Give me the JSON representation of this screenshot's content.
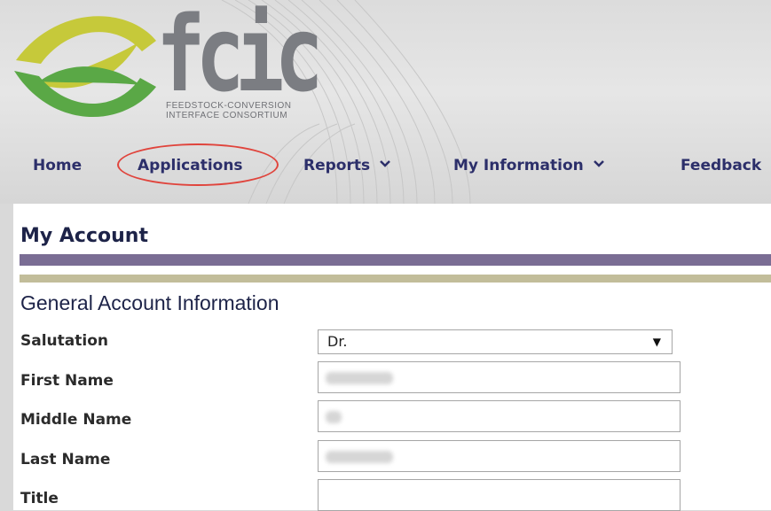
{
  "brand": {
    "logo_text": "fcic",
    "tagline_line1": "FEEDSTOCK-CONVERSION",
    "tagline_line2": "INTERFACE CONSORTIUM",
    "colors": {
      "accent_yellow": "#c6c93a",
      "accent_green": "#5aa846",
      "logo_gray": "#7b7d82"
    }
  },
  "nav": {
    "items": [
      {
        "label": "Home",
        "has_dropdown": false,
        "icon": ""
      },
      {
        "label": "Applications",
        "has_dropdown": false,
        "icon": "",
        "highlighted": true
      },
      {
        "label": "Reports",
        "has_dropdown": true,
        "icon": "chevron-down-icon"
      },
      {
        "label": "My Information",
        "has_dropdown": true,
        "icon": "chevron-down-icon"
      },
      {
        "label": "Feedback",
        "has_dropdown": false,
        "icon": ""
      }
    ],
    "chevron": "⌄",
    "highlight_color": "#e0443c"
  },
  "page": {
    "title": "My Account",
    "section_title": "General Account Information"
  },
  "form": {
    "fields": [
      {
        "label": "Salutation",
        "type": "select",
        "value": "Dr.",
        "arrow": "▼"
      },
      {
        "label": "First Name",
        "type": "text",
        "value": "",
        "redacted": true
      },
      {
        "label": "Middle Name",
        "type": "text",
        "value": "",
        "redacted": true
      },
      {
        "label": "Last Name",
        "type": "text",
        "value": "",
        "redacted": true
      },
      {
        "label": "Title",
        "type": "text",
        "value": "",
        "redacted": false
      }
    ]
  },
  "colors": {
    "heading_navy": "#1d2348",
    "nav_navy": "#2c2f6a",
    "bar_purple": "#7a6d94",
    "bar_khaki": "#c2bd9a"
  }
}
